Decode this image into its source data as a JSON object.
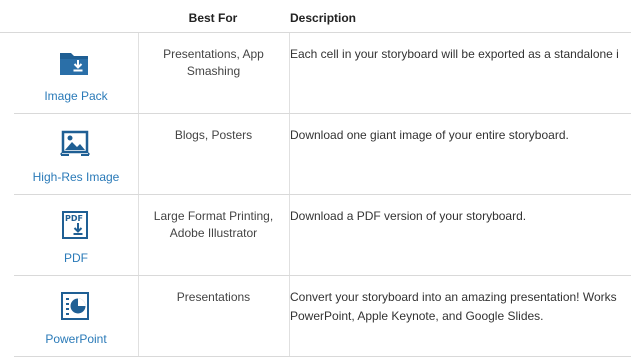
{
  "header": {
    "best_for": "Best For",
    "description": "Description"
  },
  "rows": [
    {
      "icon": "folder-download-icon",
      "label": "Image Pack",
      "best_for": "Presentations, App Smashing",
      "description": "Each cell in your storyboard will be exported as a standalone i"
    },
    {
      "icon": "image-icon",
      "label": "High-Res Image",
      "best_for": "Blogs, Posters",
      "description": "Download one giant image of your entire storyboard."
    },
    {
      "icon": "pdf-download-icon",
      "label": "PDF",
      "best_for": "Large Format Printing, Adobe Illustrator",
      "description": "Download a PDF version of your storyboard."
    },
    {
      "icon": "presentation-chart-icon",
      "label": "PowerPoint",
      "best_for": "Presentations",
      "description": "Convert your storyboard into an amazing presentation! Works",
      "description_line2": "PowerPoint, Apple Keynote, and Google Slides."
    }
  ],
  "colors": {
    "accent": "#2a7ab8",
    "icon": "#1f5f94",
    "border": "#d9d9d9"
  }
}
